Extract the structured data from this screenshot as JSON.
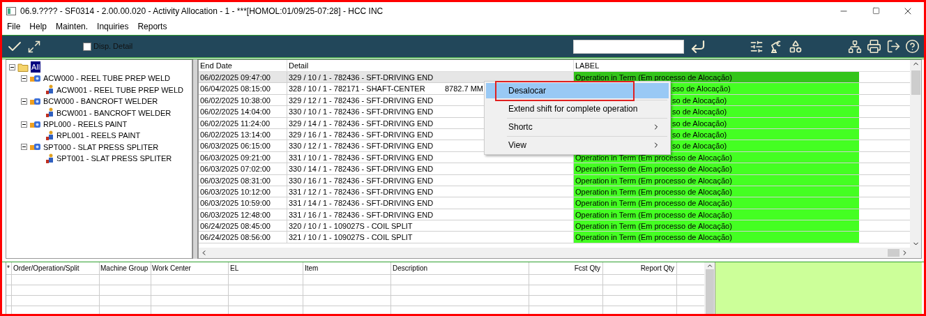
{
  "window": {
    "title": "06.9.???? - SF0314 - 2.00.00.020 - Activity Allocation - 1 - ***[HOMOL:01/09/25-07:28] - HCC INC"
  },
  "menu_bar": [
    "File",
    "Help",
    "Mainten.",
    "Inquiries",
    "Reports"
  ],
  "toolbar": {
    "disp_detail": {
      "label": "Disp. Detail",
      "checked": false
    }
  },
  "tree": {
    "label": "All",
    "selected": true,
    "expanded": true,
    "children": [
      {
        "label": "ACW000 - REEL TUBE PREP WELD",
        "expanded": true,
        "children": [
          {
            "label": "ACW001 - REEL TUBE PREP WELD"
          }
        ]
      },
      {
        "label": "BCW000 - BANCROFT WELDER",
        "expanded": true,
        "children": [
          {
            "label": "BCW001 - BANCROFT WELDER"
          }
        ]
      },
      {
        "label": "RPL000 - REELS PAINT",
        "expanded": true,
        "children": [
          {
            "label": "RPL001 - REELS PAINT"
          }
        ]
      },
      {
        "label": "SPT000 - SLAT PRESS SPLITER",
        "expanded": true,
        "children": [
          {
            "label": "SPT001 - SLAT PRESS SPLITER"
          }
        ]
      }
    ]
  },
  "table": {
    "columns": [
      "End Date",
      "Detail",
      "LABEL"
    ],
    "rows": [
      {
        "end_date": "06/02/2025 09:47:00",
        "detail": "329 / 10 / 1 - 782436 - SFT-DRIVING END",
        "label": "Operation in Term (Em processo de Alocação)",
        "selected": true,
        "label_covered": false
      },
      {
        "end_date": "06/04/2025 08:15:00",
        "detail": "328 / 10 / 1 - 782171 - SHAFT-CENTER",
        "quantity": "8782.7 MM",
        "label": "sso de Alocação)",
        "selected": false,
        "label_covered": true
      },
      {
        "end_date": "06/02/2025 10:38:00",
        "detail": "329 / 12 / 1 - 782436 - SFT-DRIVING END",
        "label": "so de Alocação)",
        "selected": false,
        "label_covered": true
      },
      {
        "end_date": "06/02/2025 14:04:00",
        "detail": "330 / 10 / 1 - 782436 - SFT-DRIVING END",
        "label": "so de Alocação)",
        "selected": false,
        "label_covered": true
      },
      {
        "end_date": "06/02/2025 11:24:00",
        "detail": "329 / 14 / 1 - 782436 - SFT-DRIVING END",
        "label": "so de Alocação)",
        "selected": false,
        "label_covered": true
      },
      {
        "end_date": "06/02/2025 13:14:00",
        "detail": "329 / 16 / 1 - 782436 - SFT-DRIVING END",
        "label": "so de Alocação)",
        "selected": false,
        "label_covered": true
      },
      {
        "end_date": "06/03/2025 06:15:00",
        "detail": "330 / 12 / 1 - 782436 - SFT-DRIVING END",
        "label": "so de Alocação)",
        "selected": false,
        "label_covered": true
      },
      {
        "end_date": "06/03/2025 09:21:00",
        "detail": "331 / 10 / 1 - 782436 - SFT-DRIVING END",
        "label": "Operation in Term (Em processo de Alocação)",
        "selected": false,
        "label_covered": false
      },
      {
        "end_date": "06/03/2025 07:02:00",
        "detail": "330 / 14 / 1 - 782436 - SFT-DRIVING END",
        "label": "Operation in Term (Em processo de Alocação)",
        "selected": false,
        "label_covered": false
      },
      {
        "end_date": "06/03/2025 08:31:00",
        "detail": "330 / 16 / 1 - 782436 - SFT-DRIVING END",
        "label": "Operation in Term (Em processo de Alocação)",
        "selected": false,
        "label_covered": false
      },
      {
        "end_date": "06/03/2025 10:12:00",
        "detail": "331 / 12 / 1 - 782436 - SFT-DRIVING END",
        "label": "Operation in Term (Em processo de Alocação)",
        "selected": false,
        "label_covered": false
      },
      {
        "end_date": "06/03/2025 10:59:00",
        "detail": "331 / 14 / 1 - 782436 - SFT-DRIVING END",
        "label": "Operation in Term (Em processo de Alocação)",
        "selected": false,
        "label_covered": false
      },
      {
        "end_date": "06/03/2025 12:48:00",
        "detail": "331 / 16 / 1 - 782436 - SFT-DRIVING END",
        "label": "Operation in Term (Em processo de Alocação)",
        "selected": false,
        "label_covered": false
      },
      {
        "end_date": "06/24/2025 08:45:00",
        "detail": "320 / 10 / 1 - 109027S - COIL SPLIT",
        "label": "Operation in Term (Em processo de Alocação)",
        "selected": false,
        "label_covered": false
      },
      {
        "end_date": "06/24/2025 08:56:00",
        "detail": "321 / 10 / 1 - 109027S - COIL SPLIT",
        "label": "Operation in Term (Em processo de Alocação)",
        "selected": false,
        "label_covered": false
      }
    ]
  },
  "context_menu": [
    {
      "label": "Desalocar",
      "selected": true,
      "submenu": false
    },
    {
      "label": "Extend shift for complete operation",
      "selected": false,
      "submenu": false
    },
    {
      "label": "Shortc",
      "selected": false,
      "submenu": true
    },
    {
      "label": "View",
      "selected": false,
      "submenu": true
    }
  ],
  "bottom_grid": {
    "columns": [
      "*",
      "Order/Operation/Split",
      "Machine Group",
      "Work Center",
      "EL",
      "Item",
      "Description",
      "Fcst Qty",
      "Report Qty"
    ]
  }
}
